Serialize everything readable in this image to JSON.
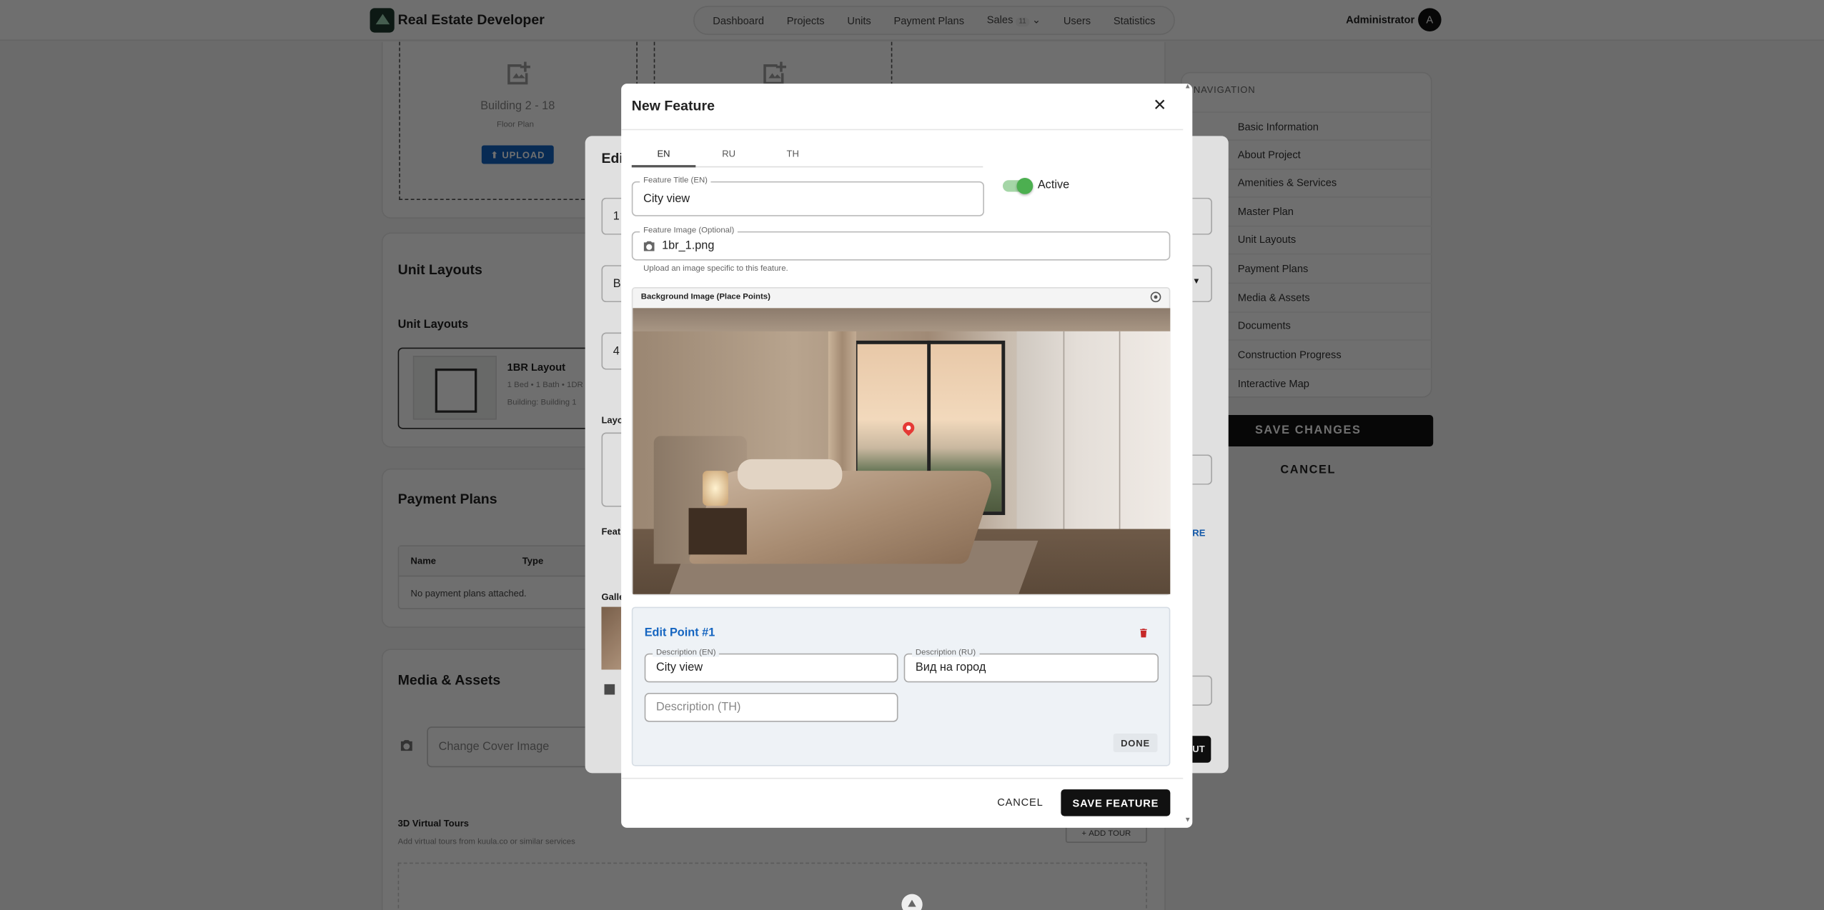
{
  "app": {
    "brand": "Real Estate Developer",
    "user": "Administrator",
    "avatar": "A"
  },
  "nav": {
    "items": [
      "Dashboard",
      "Projects",
      "Units",
      "Payment Plans"
    ],
    "sales": "Sales",
    "sales_badge": "11",
    "after": [
      "Users",
      "Statistics"
    ]
  },
  "bg": {
    "floor_caption": "Building 2 - 18",
    "floor_sub": "Floor Plan",
    "upload": "UPLOAD",
    "unit_layouts_h": "Unit Layouts",
    "unit_layouts_sub": "Unit Layouts",
    "layout_name": "1BR Layout",
    "layout_meta": "1 Bed • 1 Bath • 1DR",
    "layout_building": "Building: Building 1",
    "payment_h": "Payment Plans",
    "col_name": "Name",
    "col_type": "Type",
    "no_plans": "No payment plans attached.",
    "media_h": "Media & Assets",
    "cover_ph": "Change Cover Image",
    "tours_h": "3D Virtual Tours",
    "tours_sub": "Add virtual tours from kuula.co or similar services",
    "add_tour": "ADD TOUR",
    "edit_partial": "Edi",
    "layout_partial": "Layo",
    "feat_partial": "Feat",
    "gallery_partial": "Galle",
    "b_partial": "B",
    "one_partial": "1",
    "four_partial": "4",
    "ut_partial": "UT",
    "re_partial": "RE"
  },
  "sidenav": {
    "title": "NAVIGATION",
    "items": [
      "Basic Information",
      "About Project",
      "Amenities & Services",
      "Master Plan",
      "Unit Layouts",
      "Payment Plans",
      "Media & Assets",
      "Documents",
      "Construction Progress",
      "Interactive Map"
    ],
    "save": "SAVE CHANGES",
    "cancel": "CANCEL"
  },
  "modal": {
    "title": "New Feature",
    "tabs": [
      "EN",
      "RU",
      "TH"
    ],
    "active_tab": 0,
    "title_label": "Feature Title (EN)",
    "title_value": "City view",
    "active_label": "Active",
    "active": true,
    "image_label": "Feature Image (Optional)",
    "image_value": "1br_1.png",
    "image_help": "Upload an image specific to this feature.",
    "bg_label": "Background Image (Place Points)",
    "point": {
      "heading": "Edit Point #1",
      "en_label": "Description (EN)",
      "en_value": "City view",
      "ru_label": "Description (RU)",
      "ru_value": "Вид на город",
      "th_placeholder": "Description (TH)",
      "done": "DONE"
    },
    "cancel": "CANCEL",
    "save": "SAVE FEATURE"
  },
  "colors": {
    "accent": "#1565c0",
    "toggle": "#4caf50",
    "pin": "#e53935",
    "dark": "#111111"
  }
}
